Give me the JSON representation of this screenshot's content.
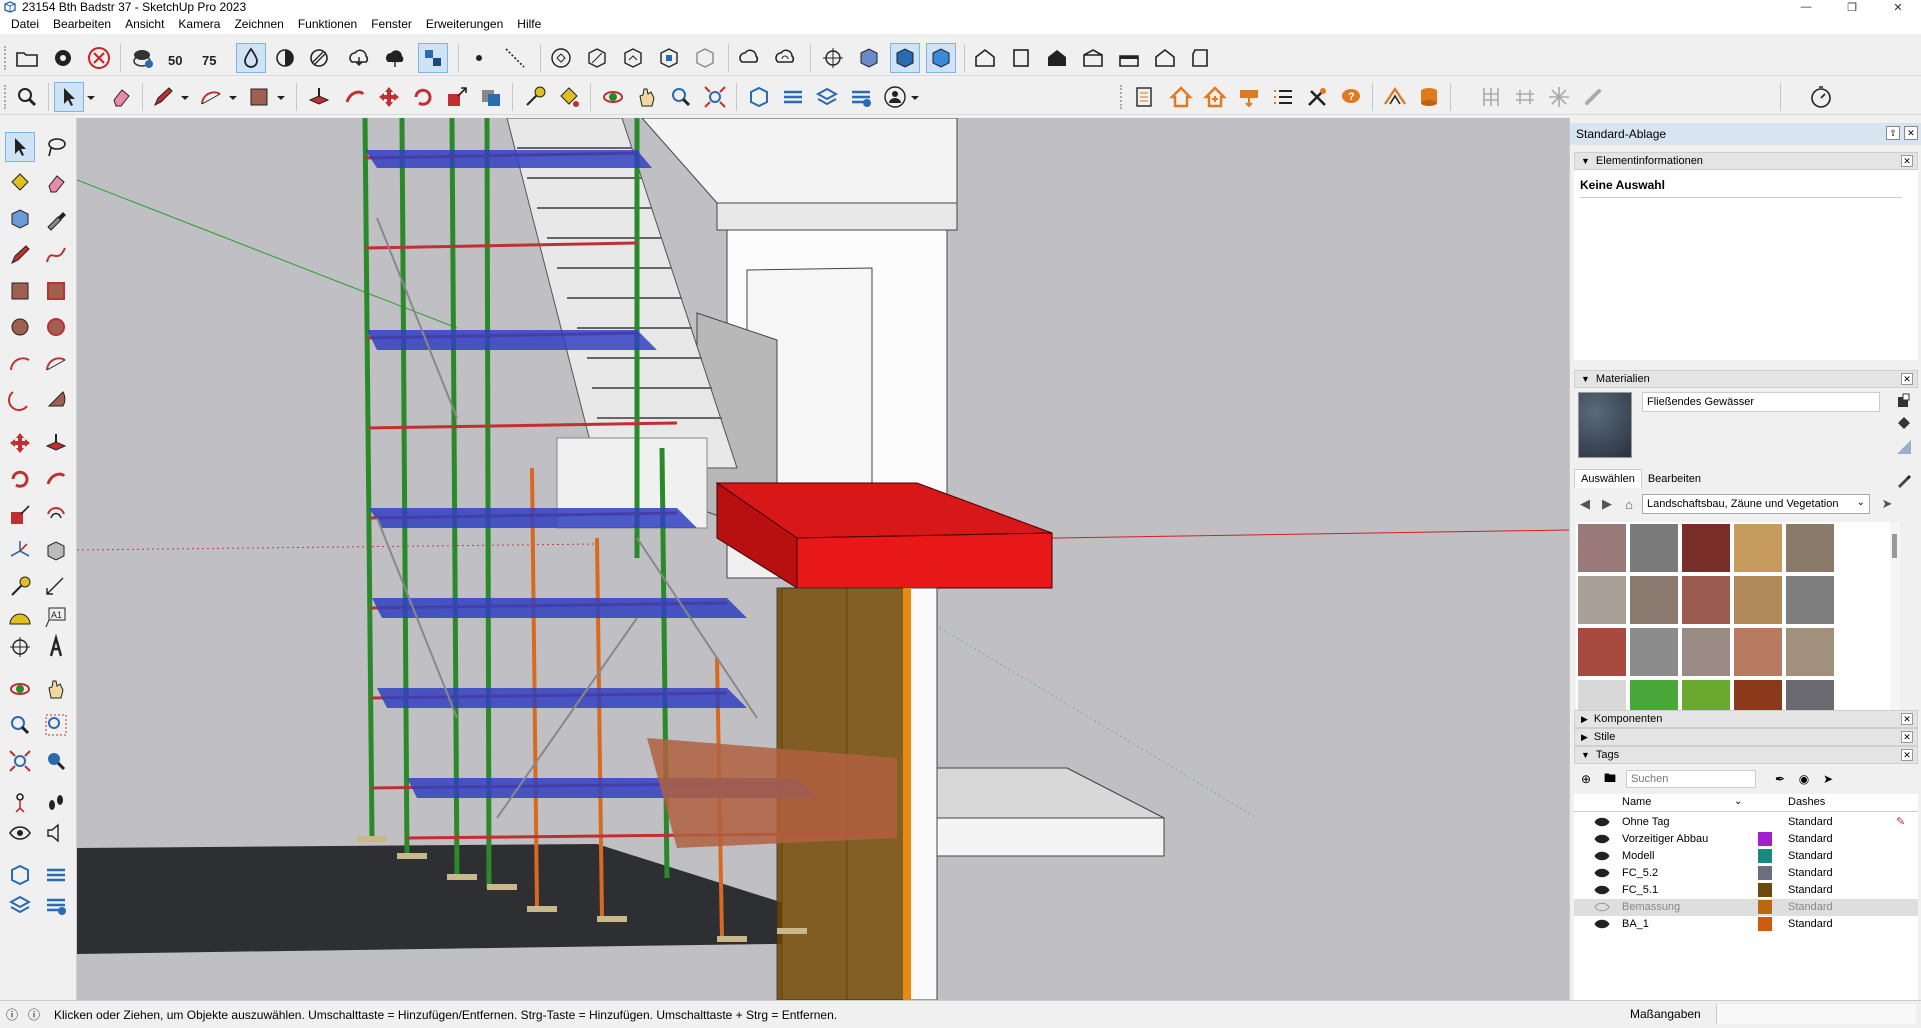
{
  "window": {
    "title": "23154 Bth Badstr 37 - SketchUp Pro 2023"
  },
  "menu": [
    "Datei",
    "Bearbeiten",
    "Ansicht",
    "Kamera",
    "Zeichnen",
    "Funktionen",
    "Fenster",
    "Erweiterungen",
    "Hilfe"
  ],
  "tray": {
    "title": "Standard-Ablage",
    "entity_info": {
      "header": "Elementinformationen",
      "selection": "Keine Auswahl"
    },
    "materials": {
      "header": "Materialien",
      "current_name": "Fließendes Gewässer",
      "tab_select": "Auswählen",
      "tab_edit": "Bearbeiten",
      "library": "Landschaftsbau, Zäune und Vegetation",
      "swatches": [
        "#9a7a78",
        "#7a7a7a",
        "#7a2e2a",
        "#c79a5e",
        "#8a7a6a",
        "#a8a096",
        "#8a7a70",
        "#9a5a50",
        "#b08a5a",
        "#7e7e7e",
        "#a84a40",
        "#8c8c8c",
        "#9a8c84",
        "#b87a60",
        "#a0907c",
        "#d8d8d8",
        "#4aa83a",
        "#6aa830",
        "#8a3a1a",
        "#6a6a70"
      ]
    },
    "components_header": "Komponenten",
    "styles_header": "Stile",
    "tags": {
      "header": "Tags",
      "search_placeholder": "Suchen",
      "col_name": "Name",
      "col_dashes": "Dashes",
      "rows": [
        {
          "name": "Ohne Tag",
          "color": "",
          "dashes": "Standard"
        },
        {
          "name": "Vorzeitiger Abbau",
          "color": "#a020d0",
          "dashes": "Standard"
        },
        {
          "name": "Modell",
          "color": "#1a8a80",
          "dashes": "Standard"
        },
        {
          "name": "FC_5.2",
          "color": "#6a7080",
          "dashes": "Standard"
        },
        {
          "name": "FC_5.1",
          "color": "#6a4a10",
          "dashes": "Standard"
        },
        {
          "name": "Bemassung",
          "color": "#b86a10",
          "dashes": "Standard"
        },
        {
          "name": "BA_1",
          "color": "#d05a10",
          "dashes": "Standard"
        }
      ]
    }
  },
  "status": {
    "message": "Klicken oder Ziehen, um Objekte auszuwählen. Umschalttaste = Hinzufügen/Entfernen. Strg-Taste = Hinzufügen. Umschalttaste + Strg = Entfernen.",
    "measurements_label": "Maßangaben"
  }
}
